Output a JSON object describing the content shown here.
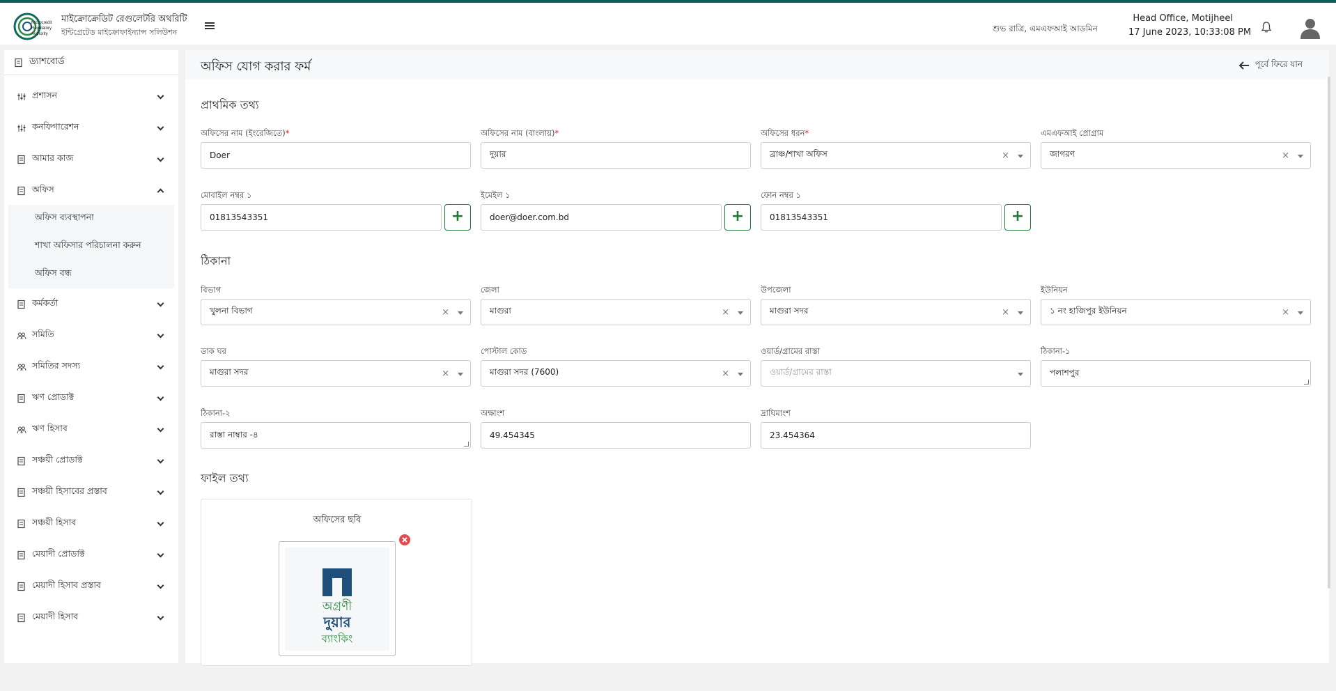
{
  "app": {
    "org_name": "মাইক্রোক্রেডিট রেগুলেটরি অথরিটি",
    "org_sub": "ইন্টিগ্রেটেড মাইক্রোফাইন্যান্স সলিউশন",
    "logo_text": [
      "Microcredit",
      "Regulatory",
      "Authority"
    ]
  },
  "header": {
    "greeting": "শুভ রাত্রি, এমএফআই আডমিন",
    "office": "Head Office, Motijheel",
    "datetime": "17 June 2023, 10:33:08 PM"
  },
  "sidebar": {
    "dashboard": "ড্যাশবোর্ড",
    "items": [
      {
        "label": "প্রশাসন",
        "icon": "sliders-icon"
      },
      {
        "label": "কনফিগারেশন",
        "icon": "sliders-icon"
      },
      {
        "label": "আমার কাজ",
        "icon": "document-icon"
      },
      {
        "label": "অফিস",
        "icon": "document-icon",
        "expanded": true
      },
      {
        "label": "কর্মকর্তা",
        "icon": "document-icon"
      },
      {
        "label": "সমিতি",
        "icon": "group-icon"
      },
      {
        "label": "সমিতির সদস্য",
        "icon": "group-icon"
      },
      {
        "label": "ঋণ প্রোডাক্ট",
        "icon": "document-icon"
      },
      {
        "label": "ঋণ হিসাব",
        "icon": "group-icon"
      },
      {
        "label": "সঞ্চয়ী প্রোডাক্ট",
        "icon": "document-icon"
      },
      {
        "label": "সঞ্চয়ী হিসাবের প্রস্তাব",
        "icon": "document-icon"
      },
      {
        "label": "সঞ্চয়ী হিসাব",
        "icon": "document-icon"
      },
      {
        "label": "মেয়াদী প্রোডাক্ট",
        "icon": "document-icon"
      },
      {
        "label": "মেয়াদী হিসাব প্রস্তাব",
        "icon": "document-icon"
      },
      {
        "label": "মেয়াদী হিসাব",
        "icon": "document-icon"
      }
    ],
    "office_sub": [
      "অফিস ব্যবস্থাপনা",
      "শাখা অফিসার পরিচালনা করুন",
      "অফিস বন্ধ"
    ]
  },
  "page": {
    "title": "অফিস যোগ করার ফর্ম",
    "back": "পূর্বে ফিরে যান"
  },
  "sections": {
    "basic": "প্রাথমিক তথ্য",
    "address": "ঠিকানা",
    "file": "ফাইল তথ্য"
  },
  "form": {
    "name_en": {
      "label": "অফিসের নাম (ইংরেজিতে)",
      "value": "Doer"
    },
    "name_bn": {
      "label": "অফিসের নাম (বাংলায়)",
      "value": "দুয়ার"
    },
    "office_type": {
      "label": "অফিসের ধরন",
      "value": "ব্রাঞ্চ/শাখা অফিস"
    },
    "mfi_program": {
      "label": "এমএফআই প্রোগ্রাম",
      "value": "জাগরণ"
    },
    "mobile": {
      "label": "মোবাইল নম্বর ১",
      "value": "01813543351"
    },
    "email": {
      "label": "ইমেইল ১",
      "value": "doer@doer.com.bd"
    },
    "phone": {
      "label": "ফোন নম্বর ১",
      "value": "01813543351"
    },
    "division": {
      "label": "বিভাগ",
      "value": "খুলনা বিভাগ"
    },
    "district": {
      "label": "জেলা",
      "value": "মাগুরা"
    },
    "upazila": {
      "label": "উপজেলা",
      "value": "মাগুরা সদর"
    },
    "union": {
      "label": "ইউনিয়ন",
      "value": "১ নং হাজিপুর ইউনিয়ন"
    },
    "post_office": {
      "label": "ডাক ঘর",
      "value": "মাগুরা সদর"
    },
    "postal_code": {
      "label": "পোস্টাল কোড",
      "value": "মাগুরা সদর (7600)"
    },
    "ward_road": {
      "label": "ওয়ার্ড/গ্রামের রাস্তা",
      "placeholder": "ওয়ার্ড/গ্রামের রাস্তা"
    },
    "address1": {
      "label": "ঠিকানা-১",
      "value": "পলাশপুর"
    },
    "address2": {
      "label": "ঠিকানা-২",
      "value": "রাস্তা নাম্বার -৪"
    },
    "latitude": {
      "label": "অক্ষাংশ",
      "value": "49.454345"
    },
    "longitude": {
      "label": "দ্রাঘিমাংশ",
      "value": "23.454364"
    }
  },
  "file": {
    "label": "অফিসের ছবি",
    "image_text": [
      "অগ্রণী",
      "দুয়ার",
      "ব্যাংকিং"
    ]
  },
  "colors": {
    "accent": "#0e5f5f",
    "green": "#1f7a3a",
    "required": "#d0202a",
    "danger": "#e5484d"
  }
}
